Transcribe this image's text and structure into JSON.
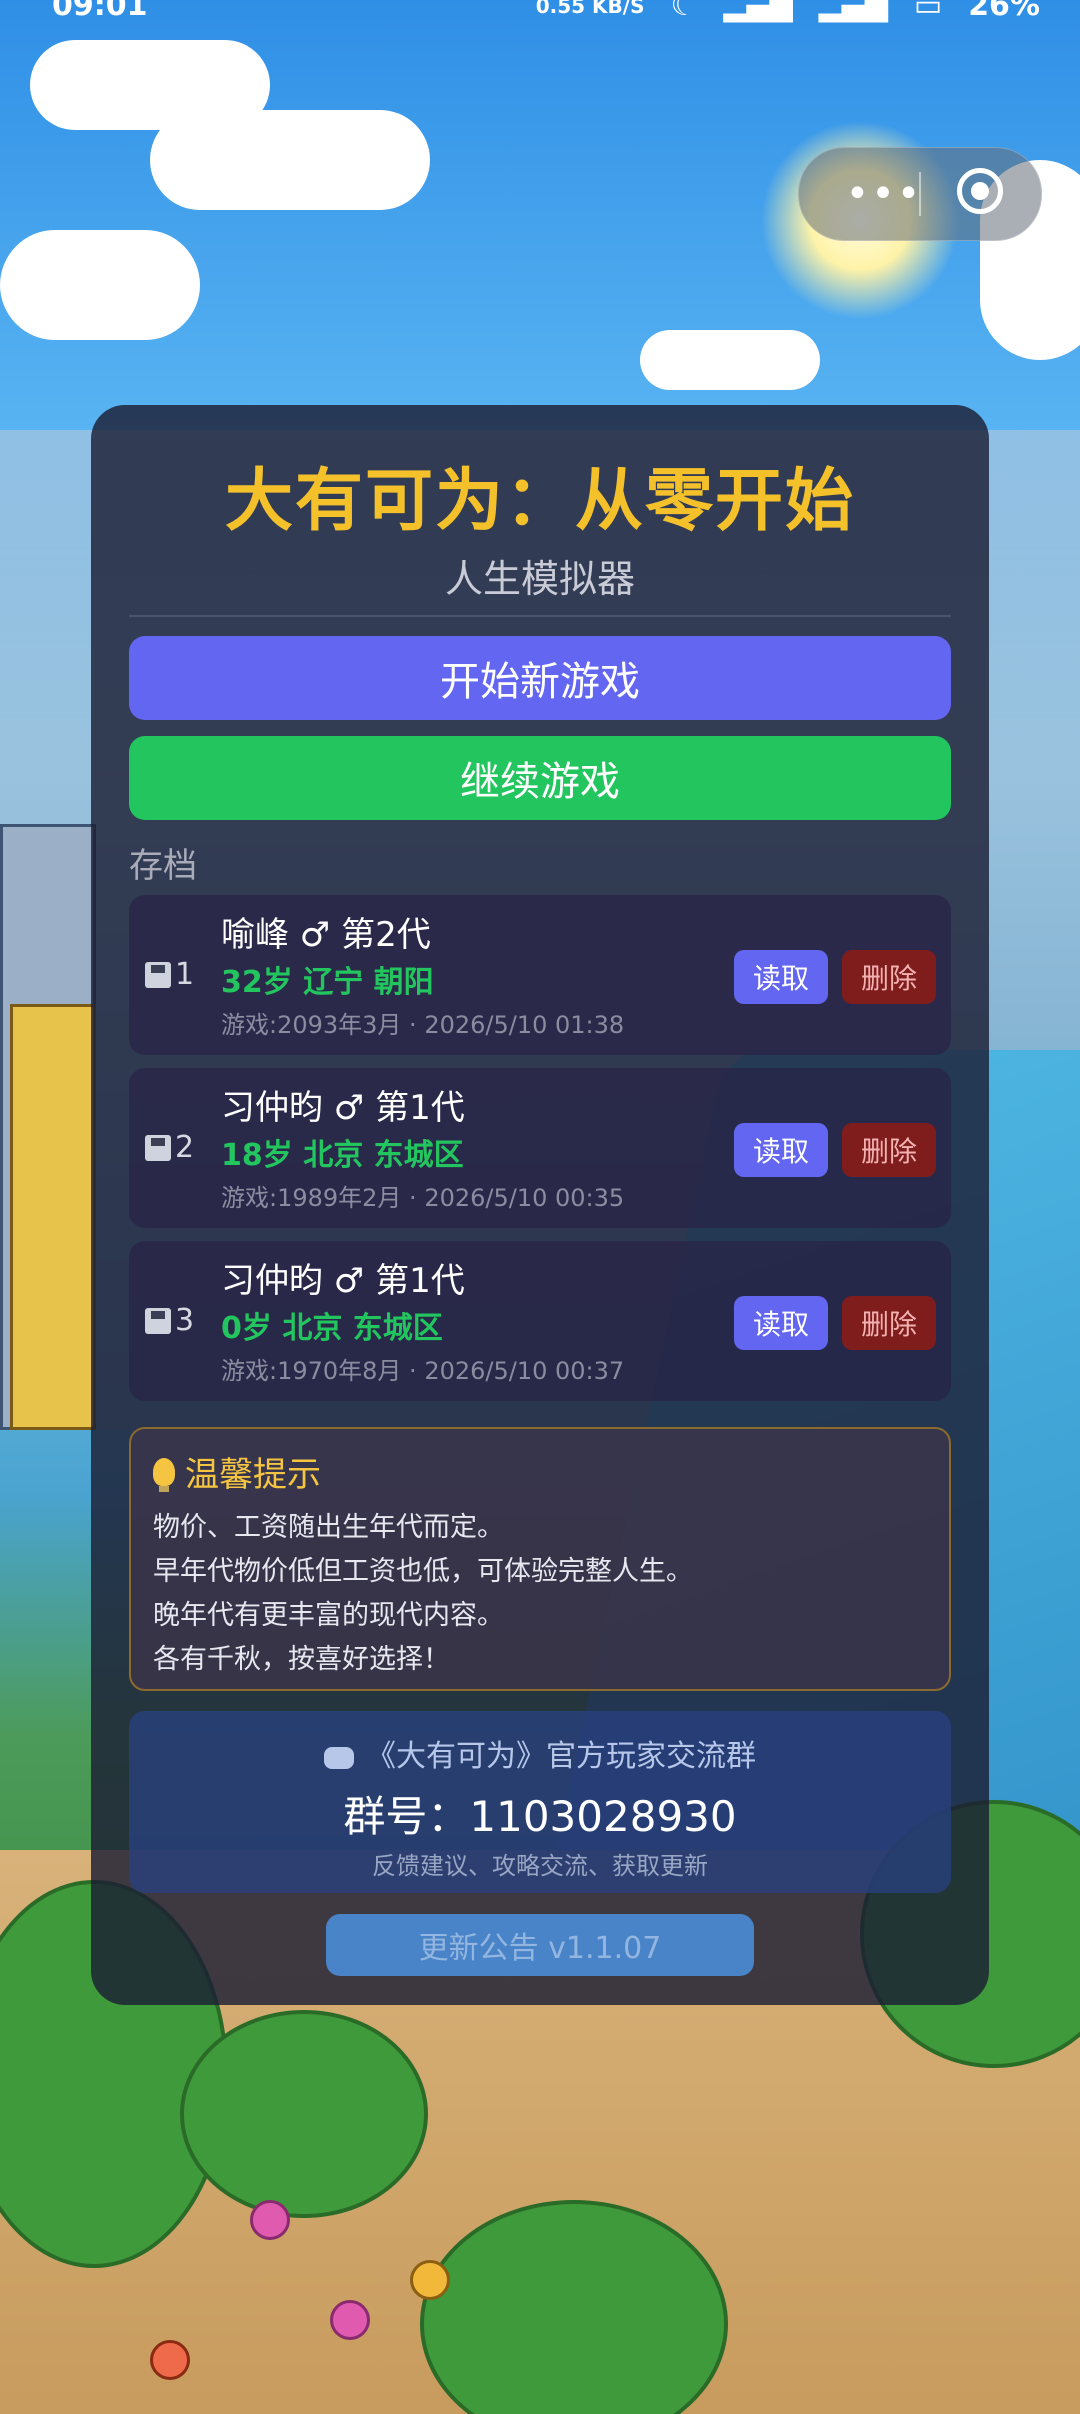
{
  "status": {
    "time": "09:01",
    "net_speed": "0.55 KB/S",
    "battery": "26%"
  },
  "capsule": {
    "more_icon": "more-dots-icon",
    "close_icon": "target-icon"
  },
  "game": {
    "title": "大有可为：从零开始",
    "subtitle": "人生模拟器",
    "new_game": "开始新游戏",
    "continue_game": "继续游戏",
    "saves_label": "存档"
  },
  "saves": [
    {
      "slot": "1",
      "name": "喻峰 ♂ 第2代",
      "info": "32岁  辽宁 朝阳",
      "meta": "游戏:2093年3月 · 2026/5/10 01:38",
      "read": "读取",
      "delete": "删除"
    },
    {
      "slot": "2",
      "name": "习仲昀 ♂ 第1代",
      "info": "18岁  北京 东城区",
      "meta": "游戏:1989年2月 · 2026/5/10 00:35",
      "read": "读取",
      "delete": "删除"
    },
    {
      "slot": "3",
      "name": "习仲昀 ♂ 第1代",
      "info": "0岁  北京 东城区",
      "meta": "游戏:1970年8月 · 2026/5/10 00:37",
      "read": "读取",
      "delete": "删除"
    }
  ],
  "tips": {
    "title": "温馨提示",
    "lines": [
      "物价、工资随出生年代而定。",
      "早年代物价低但工资也低，可体验完整人生。",
      "晚年代有更丰富的现代内容。",
      "各有千秋，按喜好选择！"
    ]
  },
  "group": {
    "title": "《大有可为》官方玩家交流群",
    "number": "群号：1103028930",
    "desc": "反馈建议、攻略交流、获取更新"
  },
  "update": "更新公告 v1.1.07",
  "colors": {
    "title": "#f4c12b",
    "new_game": "#6366f1",
    "continue_game": "#22c55e",
    "info_green": "#22c55e",
    "delete": "#7f1d1d"
  }
}
